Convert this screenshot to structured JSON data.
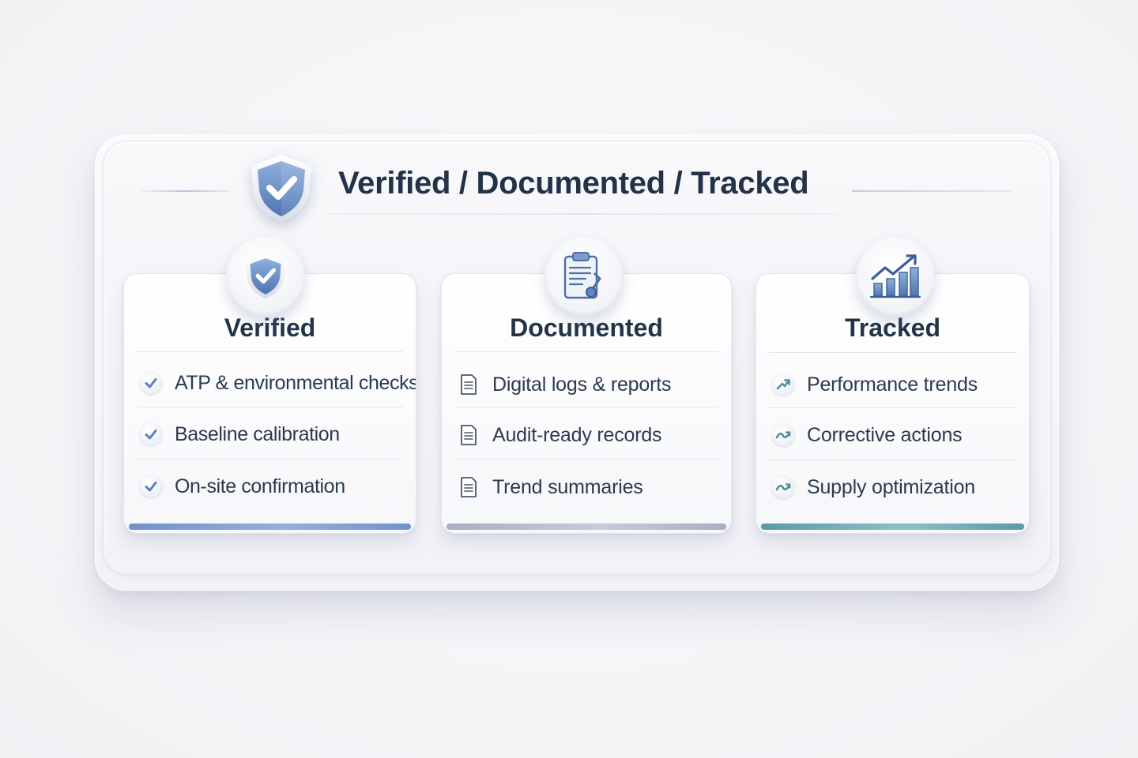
{
  "header": {
    "title": "Verified / Documented / Tracked",
    "icon": "shield-check-icon"
  },
  "colors": {
    "title": "#223248",
    "shield_blue": "#5f87c2",
    "verified_accent": "#6f93c9",
    "documented_accent": "#a9aec4",
    "tracked_accent": "#5a9aa5"
  },
  "cards": [
    {
      "title": "Verified",
      "badge_icon": "shield-check-icon",
      "items": [
        {
          "icon": "check-icon",
          "label": "ATP & environmental checks"
        },
        {
          "icon": "check-icon",
          "label": "Baseline calibration"
        },
        {
          "icon": "check-icon",
          "label": "On-site confirmation"
        }
      ]
    },
    {
      "title": "Documented",
      "badge_icon": "clipboard-thermometer-icon",
      "items": [
        {
          "icon": "document-icon",
          "label": "Digital logs & reports"
        },
        {
          "icon": "document-icon",
          "label": "Audit-ready records"
        },
        {
          "icon": "document-icon",
          "label": "Trend summaries"
        }
      ]
    },
    {
      "title": "Tracked",
      "badge_icon": "bar-chart-trend-icon",
      "items": [
        {
          "icon": "trend-up-icon",
          "label": "Performance trends"
        },
        {
          "icon": "trend-wave-icon",
          "label": "Corrective actions"
        },
        {
          "icon": "trend-wave-icon",
          "label": "Supply optimization"
        }
      ]
    }
  ]
}
